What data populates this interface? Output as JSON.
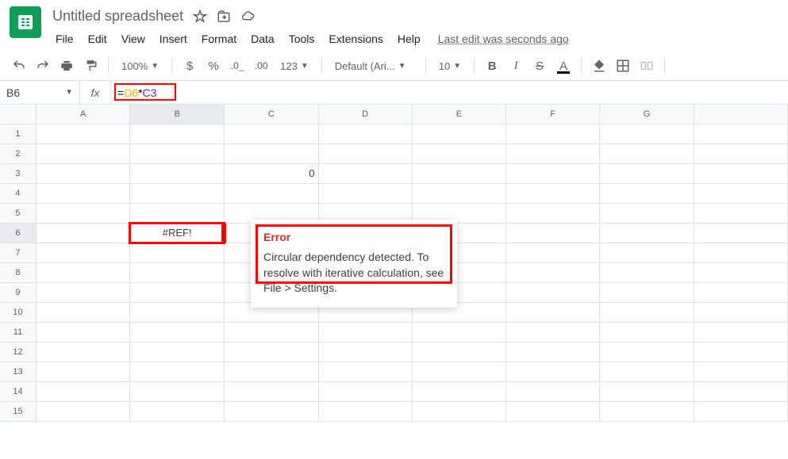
{
  "doc": {
    "title": "Untitled spreadsheet"
  },
  "menu": {
    "file": "File",
    "edit": "Edit",
    "view": "View",
    "insert": "Insert",
    "format": "Format",
    "data": "Data",
    "tools": "Tools",
    "extensions": "Extensions",
    "help": "Help",
    "last_edit": "Last edit was seconds ago"
  },
  "toolbar": {
    "zoom": "100%",
    "font": "Default (Ari...",
    "font_size": "10",
    "number_format": "123"
  },
  "formula_bar": {
    "cell": "B6",
    "fx": "fx",
    "eq": "=",
    "ref1": "D6",
    "op": "*",
    "ref2": "C3",
    "full": "=D6*C3"
  },
  "grid": {
    "cols": [
      "A",
      "B",
      "C",
      "D",
      "E",
      "F",
      "G"
    ],
    "rows": [
      "1",
      "2",
      "3",
      "4",
      "5",
      "6",
      "7",
      "8",
      "9",
      "10",
      "11",
      "12",
      "13",
      "14",
      "15"
    ],
    "c3": "0",
    "b6": "#REF!"
  },
  "error": {
    "title": "Error",
    "body": "Circular dependency detected. To resolve with iterative calculation, see File > Settings."
  }
}
